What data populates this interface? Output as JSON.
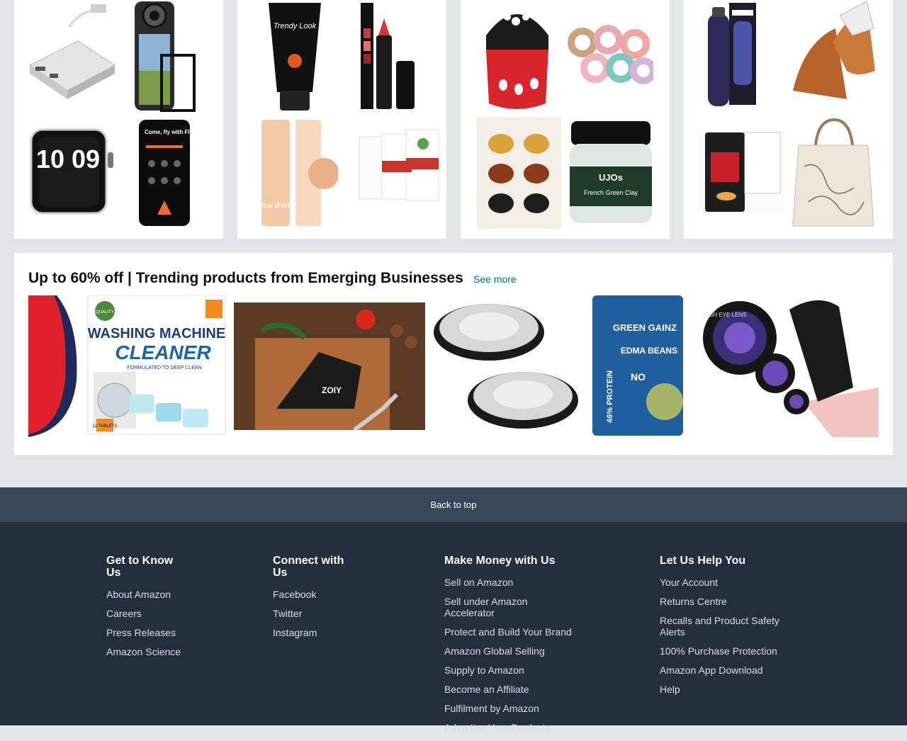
{
  "trending": {
    "title": "Up to 60% off | Trending products from Emerging Businesses",
    "see_more": "See more"
  },
  "product_text": {
    "cleaner_badge": "QUALITY",
    "cleaner_line1": "WASHING MACHINE",
    "cleaner_line2": "CLEANER",
    "cleaner_sub": "FORMULATED TO DEEP CLEAN",
    "cleaner_count": "12 TABLETS",
    "sharpener_brand": "ZOIY",
    "beans_brand": "GREEN GAINZ",
    "beans_name": "EDMA BEANS",
    "beans_protein": "46% PROTEIN",
    "beans_no": "NO",
    "clay_brand": "UJOs",
    "clay_name": "French Green Clay",
    "gel_brand": "Trendy Look",
    "cream_label": "glow shield",
    "phone_text": "Come, fly with Flyeah",
    "watch_digits": "10 09",
    "lens_text": "FISH EYE LENS"
  },
  "back_to_top": "Back to top",
  "footer": {
    "columns": [
      {
        "title": "Get to Know Us",
        "links": [
          "About Amazon",
          "Careers",
          "Press Releases",
          "Amazon Science"
        ]
      },
      {
        "title": "Connect with Us",
        "links": [
          "Facebook",
          "Twitter",
          "Instagram"
        ]
      },
      {
        "title": "Make Money with Us",
        "links": [
          "Sell on Amazon",
          "Sell under Amazon Accelerator",
          "Protect and Build Your Brand",
          "Amazon Global Selling",
          "Supply to Amazon",
          "Become an Affiliate",
          "Fulfilment by Amazon",
          "Advertise Your Products"
        ]
      },
      {
        "title": "Let Us Help You",
        "links": [
          "Your Account",
          "Returns Centre",
          "Recalls and Product Safety Alerts",
          "100% Purchase Protection",
          "Amazon App Download",
          "Help"
        ]
      }
    ]
  },
  "colors": {
    "page_bg": "#e3e6e6",
    "link": "#007185",
    "back_to_top_bg": "#37475a",
    "footer_bg": "#232f3e"
  }
}
